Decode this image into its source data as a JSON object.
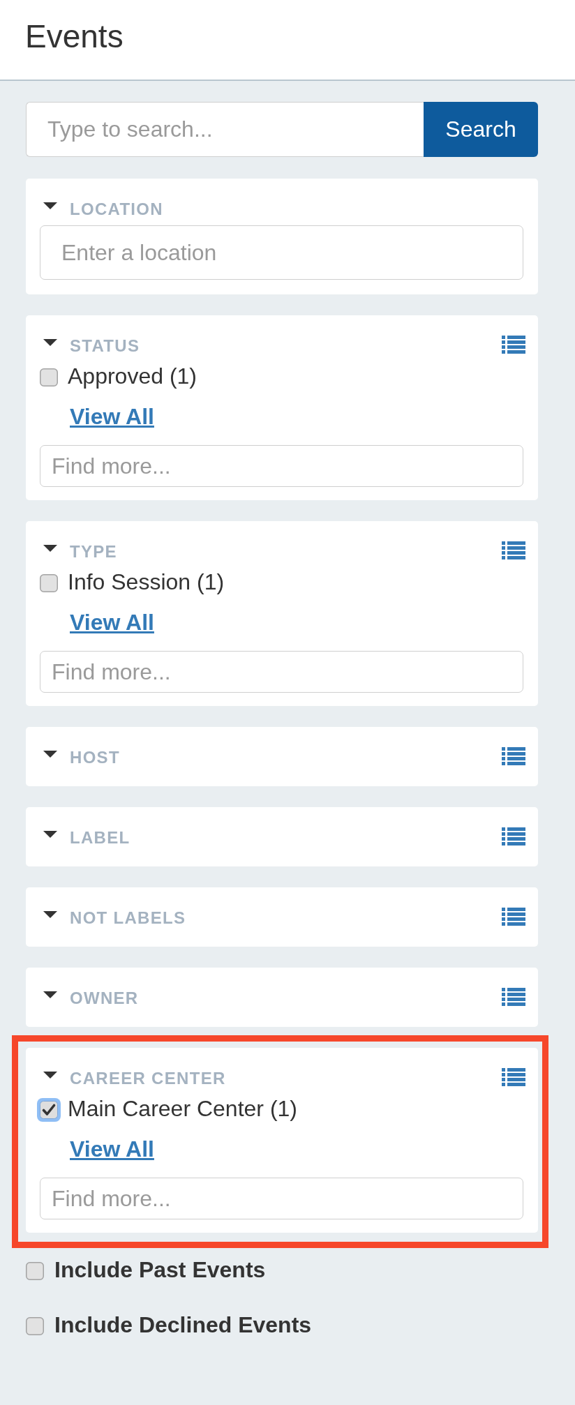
{
  "header": {
    "title": "Events"
  },
  "search": {
    "placeholder": "Type to search...",
    "button": "Search"
  },
  "panels": [
    {
      "kind": "location",
      "label": "LOCATION",
      "placeholder": "Enter a location",
      "highlighted": false
    },
    {
      "kind": "facet",
      "label": "STATUS",
      "options": [
        {
          "label": "Approved (1)",
          "checked": false
        }
      ],
      "view_all": "View All",
      "placeholder": "Find more...",
      "highlighted": false
    },
    {
      "kind": "facet",
      "label": "TYPE",
      "options": [
        {
          "label": "Info Session (1)",
          "checked": false
        }
      ],
      "view_all": "View All",
      "placeholder": "Find more...",
      "highlighted": false
    },
    {
      "kind": "facet",
      "label": "HOST",
      "highlighted": false
    },
    {
      "kind": "facet",
      "label": "LABEL",
      "highlighted": false
    },
    {
      "kind": "facet",
      "label": "NOT LABELS",
      "highlighted": false
    },
    {
      "kind": "facet",
      "label": "OWNER",
      "highlighted": false
    },
    {
      "kind": "facet",
      "label": "CAREER CENTER",
      "options": [
        {
          "label": "Main Career Center (1)",
          "checked": true
        }
      ],
      "view_all": "View All",
      "placeholder": "Find more...",
      "highlighted": true
    }
  ],
  "toggles": [
    {
      "label": "Include Past Events",
      "checked": false
    },
    {
      "label": "Include Declined Events",
      "checked": false
    }
  ]
}
